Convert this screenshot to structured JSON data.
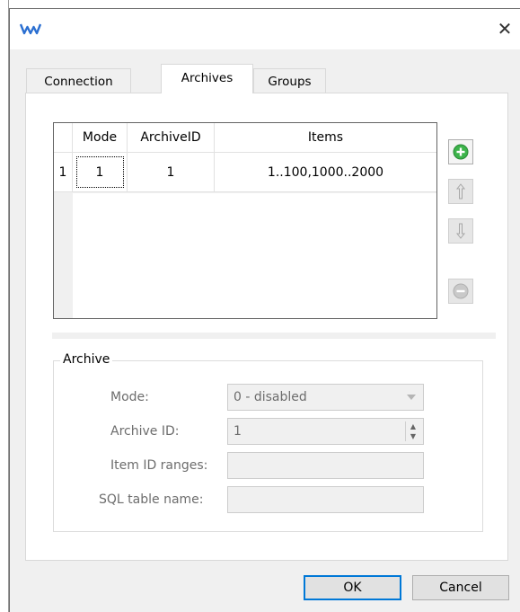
{
  "window": {
    "close_glyph": "✕"
  },
  "tabs": [
    {
      "label": "Connection",
      "active": false
    },
    {
      "label": "Archives",
      "active": true
    },
    {
      "label": "Groups",
      "active": false
    }
  ],
  "grid": {
    "columns": [
      "Mode",
      "ArchiveID",
      "Items"
    ],
    "rows": [
      {
        "index": "1",
        "mode": "1",
        "archive_id": "1",
        "items": "1..100,1000..2000"
      }
    ]
  },
  "side_buttons": [
    {
      "name": "add-button",
      "icon": "plus-circle-icon",
      "enabled": true
    },
    {
      "name": "move-up-button",
      "icon": "arrow-up-icon",
      "enabled": false
    },
    {
      "name": "move-down-button",
      "icon": "arrow-down-icon",
      "enabled": false
    },
    {
      "name": "remove-button",
      "icon": "minus-circle-icon",
      "enabled": false
    }
  ],
  "archive_group": {
    "title": "Archive",
    "mode_label": "Mode:",
    "mode_value": "0 - disabled",
    "archive_id_label": "Archive ID:",
    "archive_id_value": "1",
    "item_ranges_label": "Item ID ranges:",
    "item_ranges_value": "",
    "sql_table_label": "SQL table name:",
    "sql_table_value": ""
  },
  "buttons": {
    "ok": "OK",
    "cancel": "Cancel"
  },
  "colors": {
    "accent": "#0078d7",
    "add_icon": "#3cb34a",
    "app_icon": "#2b6fd1"
  }
}
